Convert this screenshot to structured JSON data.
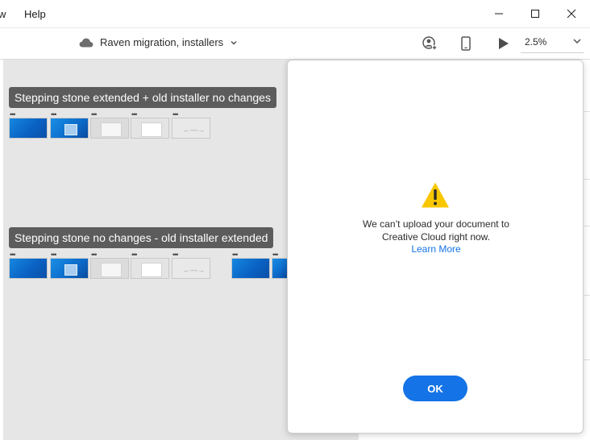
{
  "menu": {
    "items": [
      {
        "label": "w"
      },
      {
        "label": "Help"
      }
    ]
  },
  "window_controls": {
    "minimize_icon": "minimize-icon",
    "maximize_icon": "maximize-icon",
    "close_icon": "close-icon"
  },
  "toolbar": {
    "document_title": "Raven migration, installers",
    "cloud_icon": "cloud-icon",
    "share_icon": "share-user-icon",
    "device_icon": "mobile-device-icon",
    "play_icon": "play-icon",
    "zoom_value": "2.5%"
  },
  "canvas": {
    "flows": [
      {
        "label": "Stepping stone extended + old installer no changes"
      },
      {
        "label": "Stepping stone no changes - old installer extended"
      }
    ],
    "thumb_dots": "•••"
  },
  "dialog": {
    "message_line1": "We can’t upload your document to",
    "message_line2": "Creative Cloud right now.",
    "link_label": "Learn More",
    "ok_label": "OK",
    "warning_icon": "warning-icon"
  },
  "colors": {
    "accent": "#1473e6",
    "warning": "#f9c700",
    "label_bg": "#5c5c5c"
  }
}
